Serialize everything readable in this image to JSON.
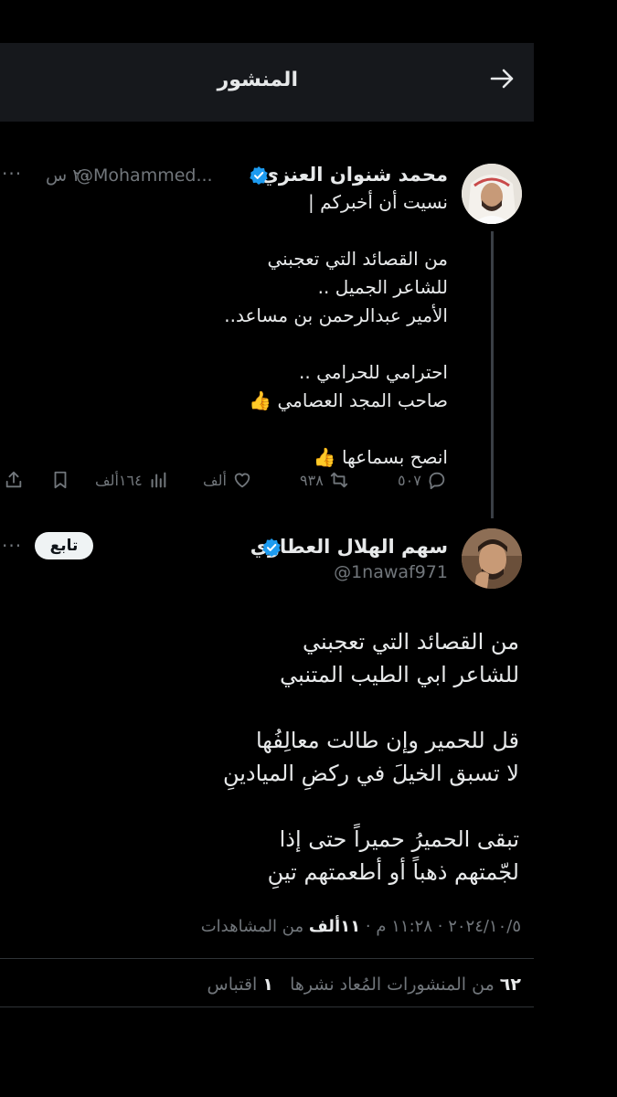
{
  "header": {
    "title": "المنشور",
    "back_icon": "arrow-right-icon"
  },
  "parent": {
    "name": "محمد شنوان العنزي",
    "handle": "@Mohammed...",
    "time": "٢٠ س",
    "more": "···",
    "text": "نسيت أن أخبركم |\n\nمن القصائد التي تعجبني\nللشاعر الجميل ..\nالأمير عبدالرحمن بن مساعد..\n\nاحترامي للحرامي ..\nصاحب المجد العصامي 👍\n\nانصح بسماعها 👍",
    "replies": "٥٠٧",
    "reposts": "٩٣٨",
    "likes": "ألف",
    "views": "١٦٤ألف"
  },
  "main": {
    "name": "سهم الهلال العطاوي",
    "handle": "@1nawaf971",
    "follow_label": "تابع",
    "more": "···",
    "text": "من القصائد التي تعجبني\nللشاعر ابي الطيب المتنبي\n\nقل للحمير وإن طالت معالِفُها\nلا تسبق الخيلَ في ركضِ الميادينِ\n\nتبقى الحميرُ حميراً حتى إذا\nلجّمتهم ذهباً أو أطعمتهم تينِ",
    "date": "٢٠٢٤/١٠/٥",
    "time": "١١:٢٨ م",
    "views_count": "١١ألف",
    "views_label": "من المشاهدات",
    "reposts_count": "٦٢",
    "reposts_label": "من المنشورات المُعاد نشرها",
    "quotes_count": "١",
    "quotes_label": "اقتباس"
  },
  "colors": {
    "verified": "#1d9bf0",
    "muted": "#71767b",
    "bg": "#000000"
  }
}
